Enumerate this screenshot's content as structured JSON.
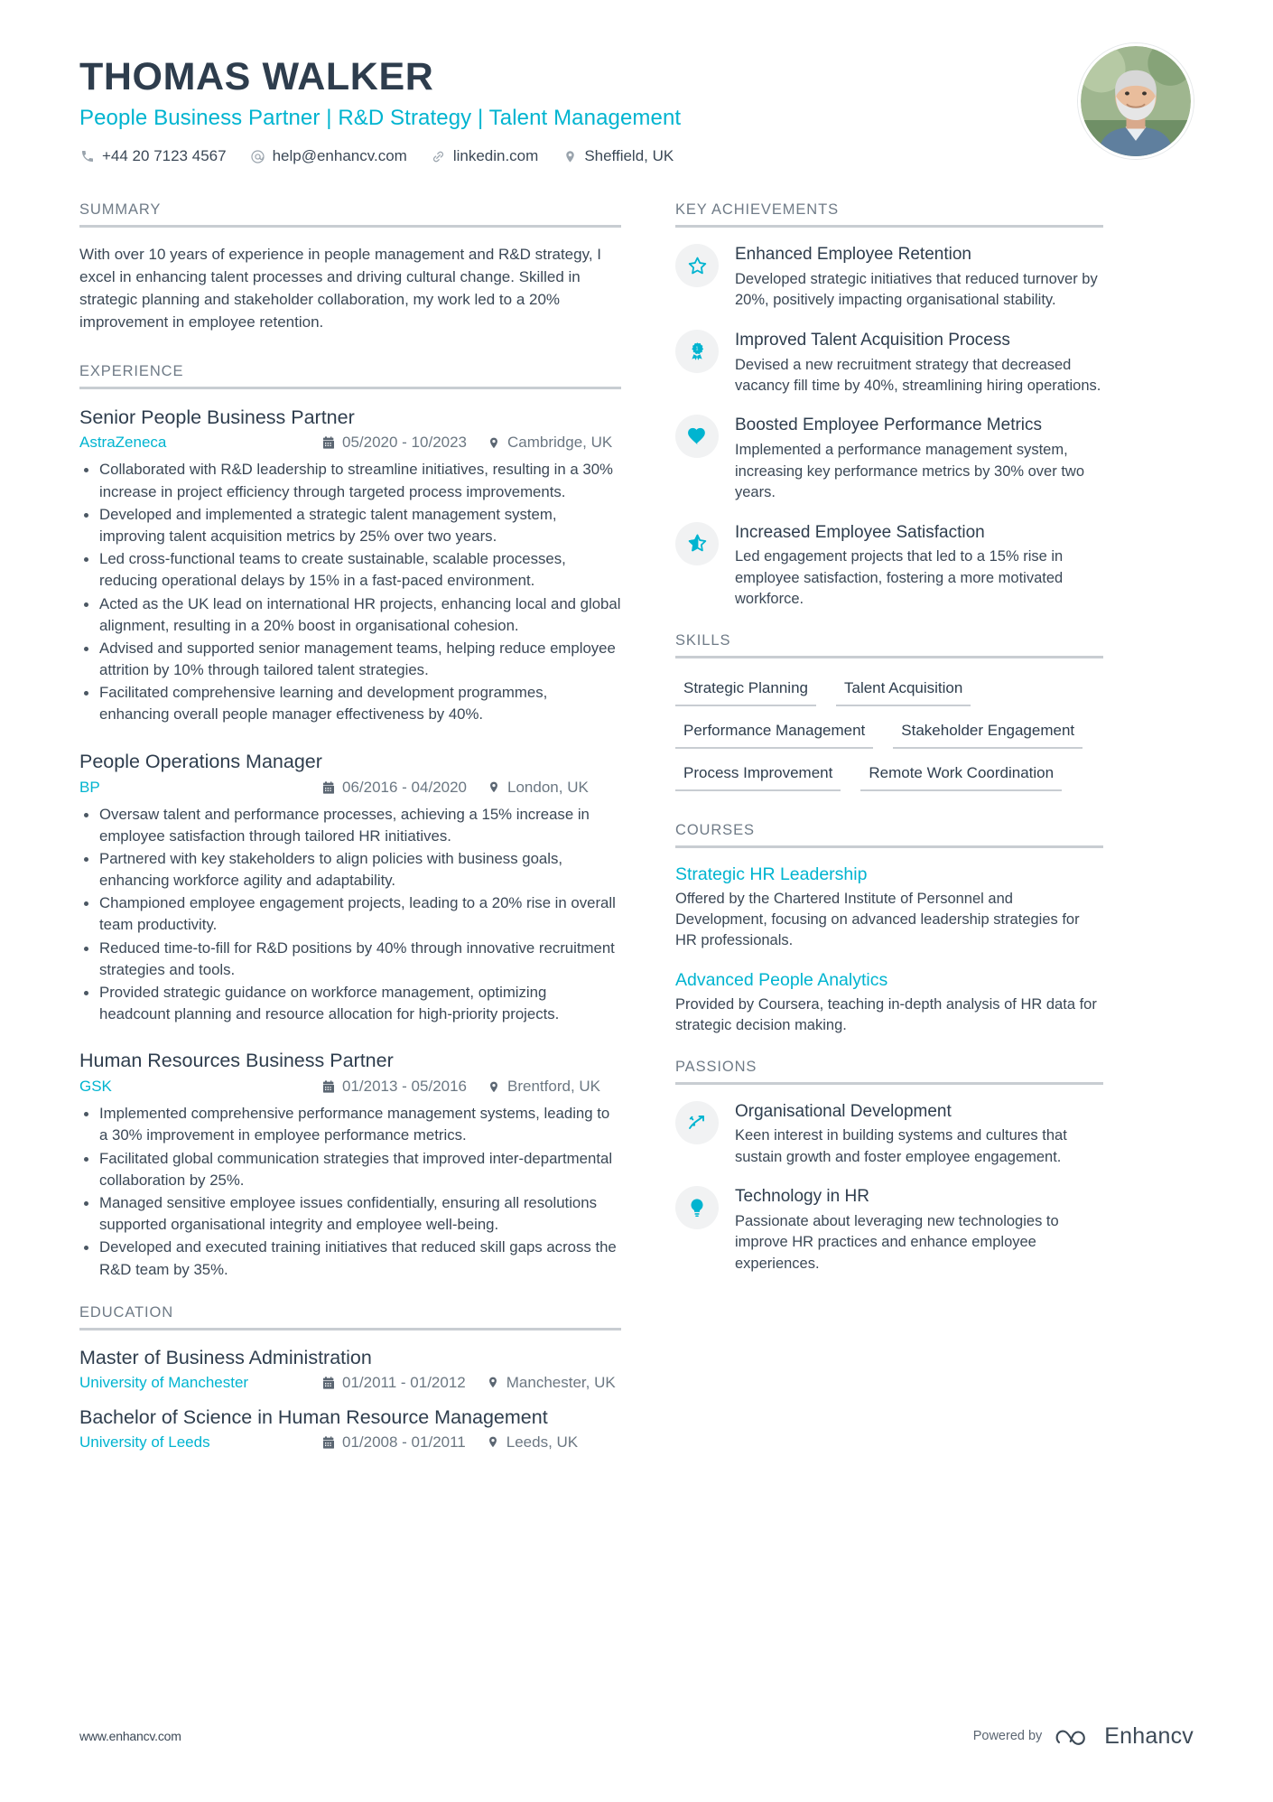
{
  "colors": {
    "accent": "#00b4d0",
    "heading_gray": "#6f7b87",
    "text": "#3b4856",
    "rule": "#c8cdd2"
  },
  "header": {
    "name": "THOMAS WALKER",
    "headline": "People Business Partner | R&D Strategy | Talent Management",
    "contacts": [
      {
        "icon": "phone-icon",
        "text": "+44 20 7123 4567"
      },
      {
        "icon": "email-icon",
        "text": "help@enhancv.com"
      },
      {
        "icon": "link-icon",
        "text": "linkedin.com"
      },
      {
        "icon": "location-pin-icon",
        "text": "Sheffield, UK"
      }
    ]
  },
  "summary": {
    "heading": "SUMMARY",
    "text": "With over 10 years of experience in people management and R&D strategy, I excel in enhancing talent processes and driving cultural change. Skilled in strategic planning and stakeholder collaboration, my work led to a 20% improvement in employee retention."
  },
  "experience": {
    "heading": "EXPERIENCE",
    "jobs": [
      {
        "title": "Senior People Business Partner",
        "company": "AstraZeneca",
        "dates": "05/2020 - 10/2023",
        "location": "Cambridge, UK",
        "bullets": [
          "Collaborated with R&D leadership to streamline initiatives, resulting in a 30% increase in project efficiency through targeted process improvements.",
          "Developed and implemented a strategic talent management system, improving talent acquisition metrics by 25% over two years.",
          "Led cross-functional teams to create sustainable, scalable processes, reducing operational delays by 15% in a fast-paced environment.",
          "Acted as the UK lead on international HR projects, enhancing local and global alignment, resulting in a 20% boost in organisational cohesion.",
          "Advised and supported senior management teams, helping reduce employee attrition by 10% through tailored talent strategies.",
          "Facilitated comprehensive learning and development programmes, enhancing overall people manager effectiveness by 40%."
        ]
      },
      {
        "title": "People Operations Manager",
        "company": "BP",
        "dates": "06/2016 - 04/2020",
        "location": "London, UK",
        "bullets": [
          "Oversaw talent and performance processes, achieving a 15% increase in employee satisfaction through tailored HR initiatives.",
          "Partnered with key stakeholders to align policies with business goals, enhancing workforce agility and adaptability.",
          "Championed employee engagement projects, leading to a 20% rise in overall team productivity.",
          "Reduced time-to-fill for R&D positions by 40% through innovative recruitment strategies and tools.",
          "Provided strategic guidance on workforce management, optimizing headcount planning and resource allocation for high-priority projects."
        ]
      },
      {
        "title": "Human Resources Business Partner",
        "company": "GSK",
        "dates": "01/2013 - 05/2016",
        "location": "Brentford, UK",
        "bullets": [
          "Implemented comprehensive performance management systems, leading to a 30% improvement in employee performance metrics.",
          "Facilitated global communication strategies that improved inter-departmental collaboration by 25%.",
          "Managed sensitive employee issues confidentially, ensuring all resolutions supported organisational integrity and employee well-being.",
          "Developed and executed training initiatives that reduced skill gaps across the R&D team by 35%."
        ]
      }
    ]
  },
  "education": {
    "heading": "EDUCATION",
    "entries": [
      {
        "degree": "Master of Business Administration",
        "school": "University of Manchester",
        "dates": "01/2011 - 01/2012",
        "location": "Manchester, UK"
      },
      {
        "degree": "Bachelor of Science in Human Resource Management",
        "school": "University of Leeds",
        "dates": "01/2008 - 01/2011",
        "location": "Leeds, UK"
      }
    ]
  },
  "key_achievements": {
    "heading": "KEY ACHIEVEMENTS",
    "items": [
      {
        "icon": "star-outline-icon",
        "title": "Enhanced Employee Retention",
        "desc": "Developed strategic initiatives that reduced turnover by 20%, positively impacting organisational stability."
      },
      {
        "icon": "award-medal-icon",
        "title": "Improved Talent Acquisition Process",
        "desc": "Devised a new recruitment strategy that decreased vacancy fill time by 40%, streamlining hiring operations."
      },
      {
        "icon": "heart-icon",
        "title": "Boosted Employee Performance Metrics",
        "desc": "Implemented a performance management system, increasing key performance metrics by 30% over two years."
      },
      {
        "icon": "star-half-icon",
        "title": "Increased Employee Satisfaction",
        "desc": "Led engagement projects that led to a 15% rise in employee satisfaction, fostering a more motivated workforce."
      }
    ]
  },
  "skills": {
    "heading": "SKILLS",
    "items": [
      "Strategic Planning",
      "Talent Acquisition",
      "Performance Management",
      "Stakeholder Engagement",
      "Process Improvement",
      "Remote Work Coordination"
    ]
  },
  "courses": {
    "heading": "COURSES",
    "items": [
      {
        "title": "Strategic HR Leadership",
        "desc": "Offered by the Chartered Institute of Personnel and Development, focusing on advanced leadership strategies for HR professionals."
      },
      {
        "title": "Advanced People Analytics",
        "desc": "Provided by Coursera, teaching in-depth analysis of HR data for strategic decision making."
      }
    ]
  },
  "passions": {
    "heading": "PASSIONS",
    "items": [
      {
        "icon": "growth-arrow-icon",
        "title": "Organisational Development",
        "desc": "Keen interest in building systems and cultures that sustain growth and foster employee engagement."
      },
      {
        "icon": "lightbulb-icon",
        "title": "Technology in HR",
        "desc": "Passionate about leveraging new technologies to improve HR practices and enhance employee experiences."
      }
    ]
  },
  "footer": {
    "url": "www.enhancv.com",
    "powered_by": "Powered by",
    "brand": "Enhancv"
  }
}
